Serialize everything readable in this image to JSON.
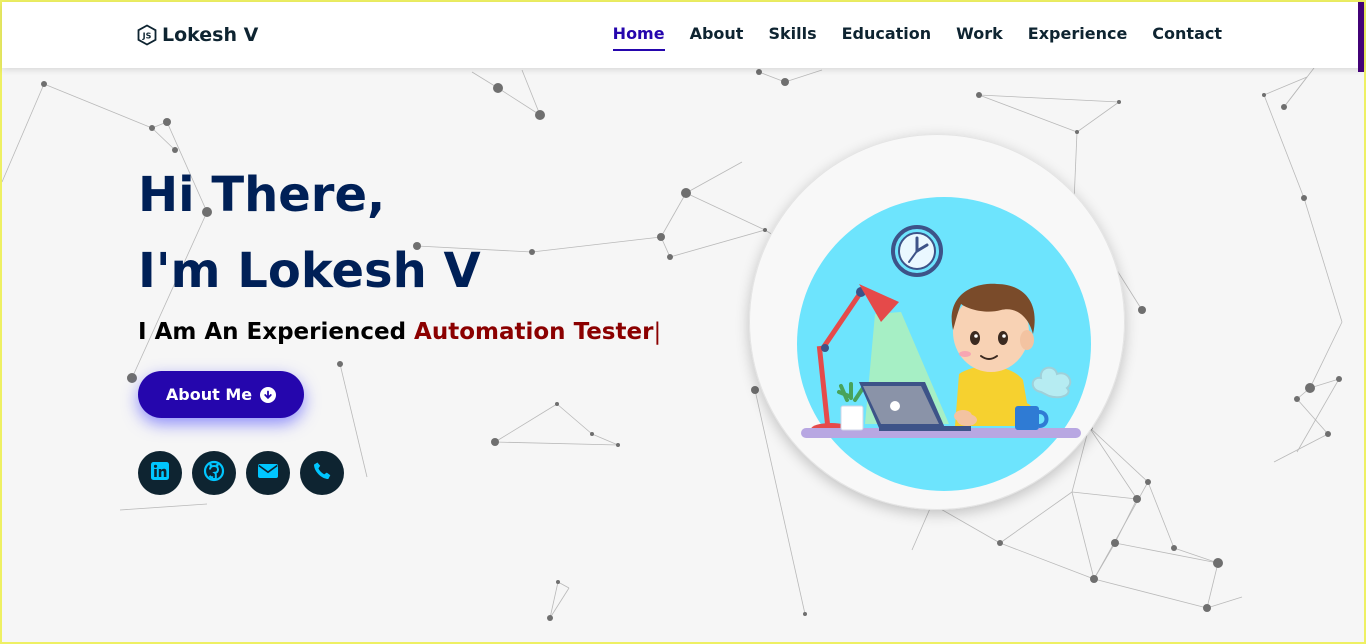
{
  "nav": {
    "brand": "Lokesh V",
    "links": [
      "Home",
      "About",
      "Skills",
      "Education",
      "Work",
      "Experience",
      "Contact"
    ],
    "active": "Home"
  },
  "hero": {
    "line1": "Hi There,",
    "line2": "I'm Lokesh V",
    "tagline_prefix": "I Am An Experienced ",
    "tagline_typed": "Automation Tester",
    "tagline_cursor": "|",
    "button_label": "About Me"
  },
  "socials": [
    "linkedin-icon",
    "github-icon",
    "envelope-icon",
    "phone-icon"
  ],
  "colors": {
    "accent": "#2506ad",
    "heading": "#002057",
    "typed": "#8b0000",
    "social_bg": "#0e2431",
    "social_icon": "#00c6ff",
    "avatar_bg": "#6de4fd"
  }
}
